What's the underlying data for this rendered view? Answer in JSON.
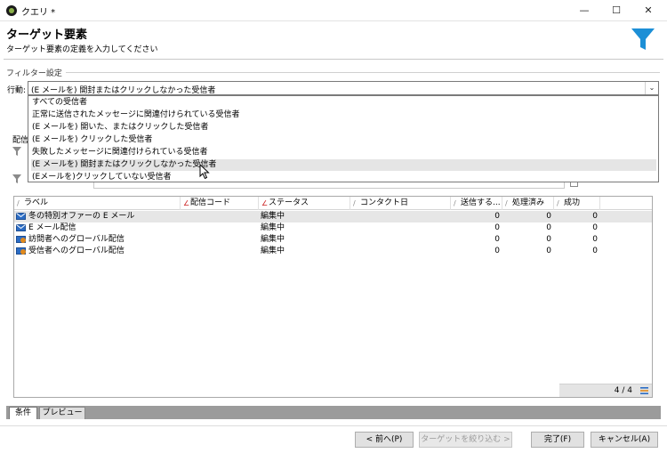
{
  "window": {
    "title": "クエリ *",
    "controls": [
      "—",
      "☐",
      "✕"
    ]
  },
  "header": {
    "title": "ターゲット要素",
    "subtitle": "ターゲット要素の定義を入力してください"
  },
  "filter": {
    "group_label": "フィルター設定",
    "action_label": "行動:",
    "selected": "(E メールを) 開封またはクリックしなかった受信者",
    "options": [
      "すべての受信者",
      "正常に送信されたメッセージに関連付けられている受信者",
      "(E メールを) 開いた、またはクリックした受信者",
      "(E メールを) クリックした受信者",
      "失敗したメッセージに関連付けられている受信者",
      "(E メールを) 開封またはクリックしなかった受信者",
      "(Eメールを)クリックしていない受信者"
    ],
    "hovered_index": 5,
    "behind_label": "配信"
  },
  "grid": {
    "columns": [
      "ラベル",
      "配信コード",
      "ステータス",
      "コンタクト日",
      "送信する...",
      "処理済み",
      "成功"
    ],
    "rows": [
      {
        "icon": "email-icon",
        "label": "冬の特別オファーの E メール",
        "code": "",
        "status": "編集中",
        "date": "",
        "to_send": "0",
        "processed": "0",
        "success": "0"
      },
      {
        "icon": "email-icon",
        "label": "E メール配信",
        "code": "",
        "status": "編集中",
        "date": "",
        "to_send": "0",
        "processed": "0",
        "success": "0"
      },
      {
        "icon": "global-delivery-icon",
        "label": "訪問者へのグローバル配信",
        "code": "",
        "status": "編集中",
        "date": "",
        "to_send": "0",
        "processed": "0",
        "success": "0"
      },
      {
        "icon": "global-delivery-icon",
        "label": "受信者へのグローバル配信",
        "code": "",
        "status": "編集中",
        "date": "",
        "to_send": "0",
        "processed": "0",
        "success": "0"
      }
    ],
    "count": "4 / 4"
  },
  "tabs": [
    "条件",
    "プレビュー"
  ],
  "buttons": {
    "back": "< 前へ(P)",
    "target": "ターゲットを絞り込む >",
    "finish": "完了(F)",
    "cancel": "キャンセル(A)"
  },
  "colors": {
    "accent": "#1c8fd6",
    "email_icon": "#2b6cc4",
    "global_icon": "#e08a1e"
  }
}
